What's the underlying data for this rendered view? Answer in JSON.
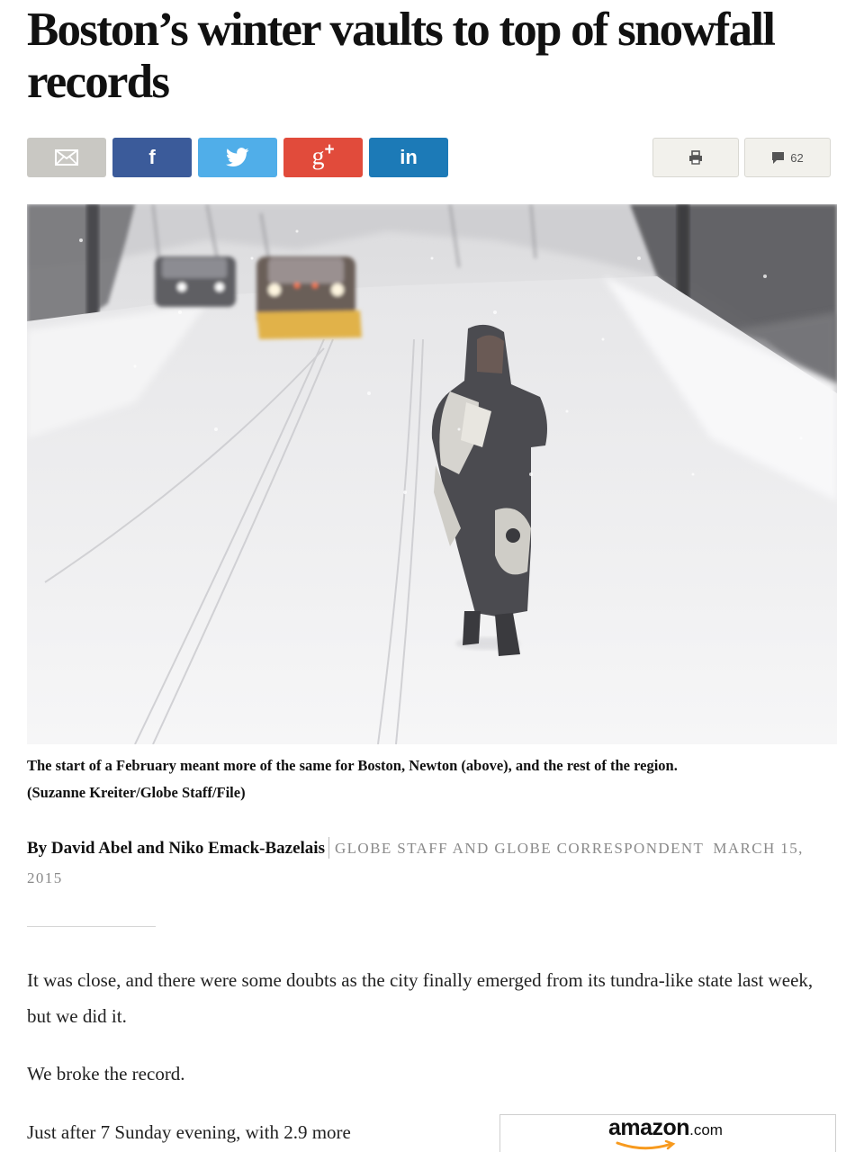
{
  "article": {
    "headline": "Boston’s winter vaults to top of snowfall records",
    "caption_line1": "The start of a February meant more of the same for Boston, Newton (above), and the rest of the region.",
    "caption_line2": "(Suzanne Kreiter/Globe Staff/File)",
    "byline": "By David Abel and Niko Emack-Bazelais",
    "byline_role": "Globe Staff and Globe Correspondent",
    "date": "March 15, 2015",
    "paragraphs": [
      "It was close, and there were some doubts as the city finally emerged from its tundra-like state last week, but we did it.",
      "We broke the record.",
      "Just after 7 Sunday evening, with 2.9 more"
    ]
  },
  "share": {
    "email_icon": "envelope-icon",
    "facebook_icon": "facebook-icon",
    "twitter_icon": "twitter-bird-icon",
    "gplus_icon": "google-plus-icon",
    "linkedin_icon": "linkedin-icon",
    "print_icon": "printer-icon",
    "comment_icon": "speech-bubble-icon",
    "comment_count": "62",
    "colors": {
      "email": "#c9c8c3",
      "facebook": "#3b5b9a",
      "twitter": "#50aee9",
      "gplus": "#e14b3b",
      "linkedin": "#1c7ab7",
      "utility": "#f2f1ec"
    }
  },
  "ad": {
    "brand": "amazon",
    "tld": ".com",
    "logo_accent": "#f79a1e"
  }
}
